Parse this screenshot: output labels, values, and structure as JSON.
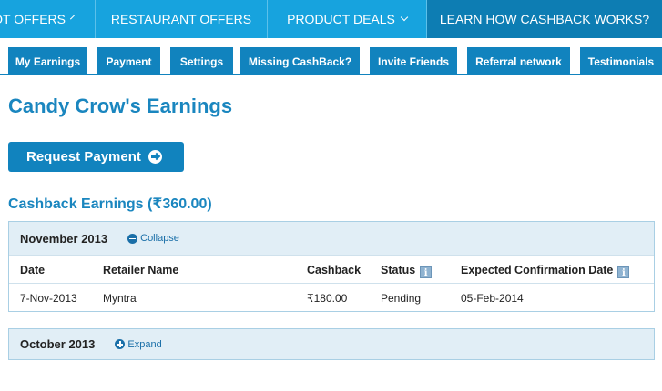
{
  "top_nav": {
    "items": [
      {
        "label": "OT OFFERS",
        "has_dropdown": true
      },
      {
        "label": "RESTAURANT OFFERS",
        "has_dropdown": false
      },
      {
        "label": "PRODUCT DEALS",
        "has_dropdown": true
      },
      {
        "label": "LEARN HOW CASHBACK WORKS?",
        "has_dropdown": false
      }
    ]
  },
  "tabs": [
    {
      "label": "My Earnings"
    },
    {
      "label": "Payment"
    },
    {
      "label": "Settings"
    },
    {
      "label": "Missing CashBack?"
    },
    {
      "label": "Invite Friends"
    },
    {
      "label": "Referral network"
    },
    {
      "label": "Testimonials"
    }
  ],
  "page_title": "Candy Crow's Earnings",
  "request_payment_label": "Request Payment",
  "earnings_heading": "Cashback Earnings (₹360.00)",
  "columns": {
    "date": "Date",
    "retailer": "Retailer Name",
    "cashback": "Cashback",
    "status": "Status",
    "expected": "Expected Confirmation Date",
    "info_glyph": "i"
  },
  "months": [
    {
      "name": "November 2013",
      "toggle_label": "Collapse",
      "expanded": true,
      "rows": [
        {
          "date": "7-Nov-2013",
          "retailer": "Myntra",
          "cashback": "₹180.00",
          "status": "Pending",
          "expected": "05-Feb-2014"
        }
      ]
    },
    {
      "name": "October 2013",
      "toggle_label": "Expand",
      "expanded": false,
      "rows": []
    }
  ],
  "colors": {
    "nav_blue": "#17a3de",
    "nav_dark": "#0d7db3",
    "tab_blue": "#1183be",
    "heading_blue": "#1a86bf",
    "section_bg": "#e1eef6"
  }
}
